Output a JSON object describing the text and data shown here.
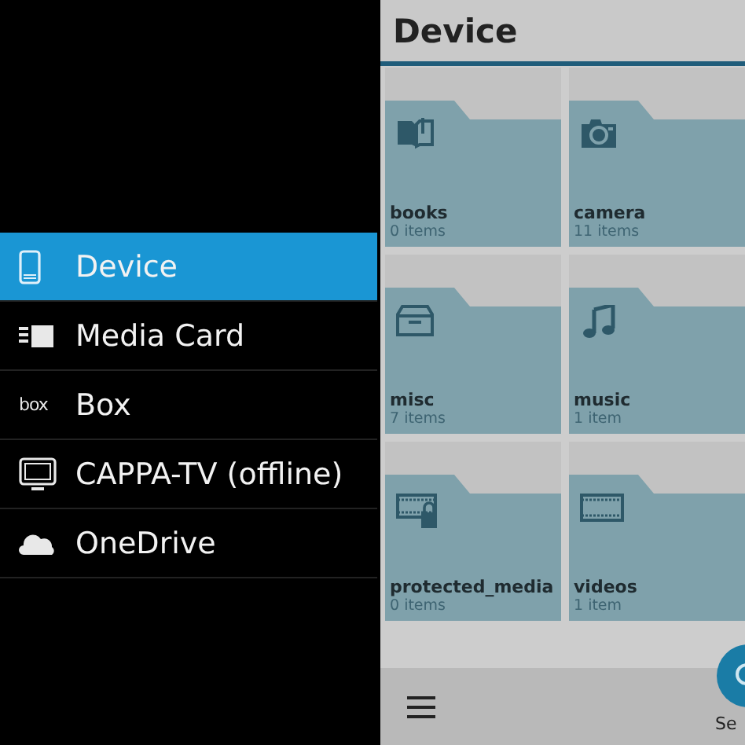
{
  "sidebar": {
    "items": [
      {
        "label": "Device",
        "kind": "phone",
        "selected": true
      },
      {
        "label": "Media Card",
        "kind": "card",
        "selected": false
      },
      {
        "label": "Box",
        "kind": "logo",
        "logo": "box",
        "selected": false
      },
      {
        "label": "CAPPA-TV (offline)",
        "kind": "monitor",
        "selected": false
      },
      {
        "label": "OneDrive",
        "kind": "cloud",
        "selected": false
      }
    ]
  },
  "header": {
    "title": "Device"
  },
  "folders": [
    {
      "name": "books",
      "count": "0 items",
      "kind": "book"
    },
    {
      "name": "camera",
      "count": "11 items",
      "kind": "camera"
    },
    {
      "name": "misc",
      "count": "7 items",
      "kind": "tray"
    },
    {
      "name": "music",
      "count": "1 item",
      "kind": "music"
    },
    {
      "name": "protected_media",
      "count": "0 items",
      "kind": "protected"
    },
    {
      "name": "videos",
      "count": "1 item",
      "kind": "video"
    }
  ],
  "bottom_bar": {
    "action_label": "Se"
  }
}
